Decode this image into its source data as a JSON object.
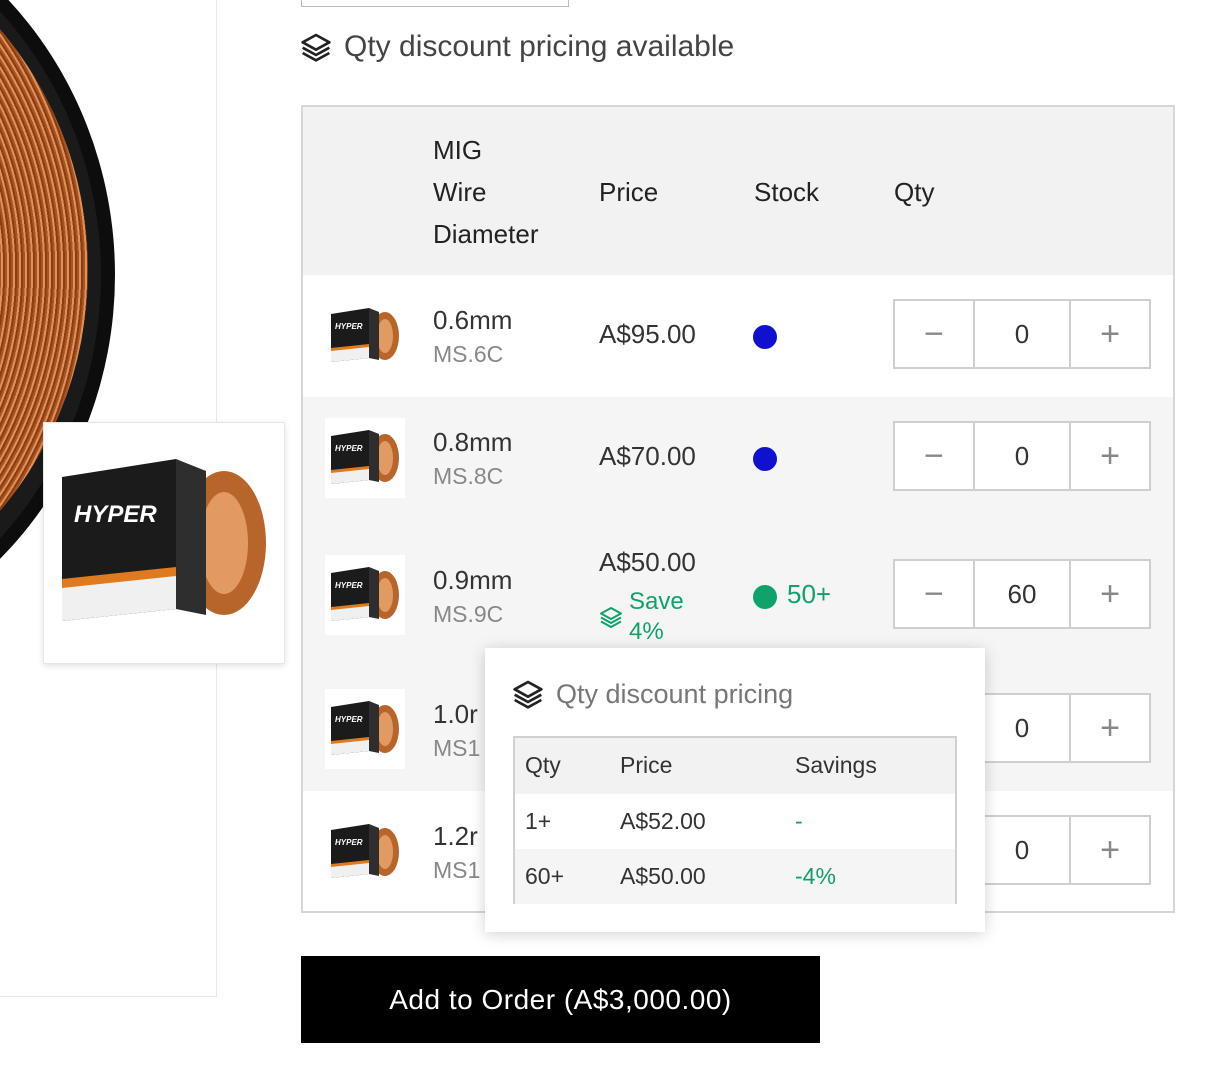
{
  "qty_note": {
    "icon": "layers-icon",
    "text": "Qty discount pricing available"
  },
  "table": {
    "headers": {
      "diameter": "MIG\nWire\nDiameter",
      "diameter_lines": [
        "MIG",
        "Wire",
        "Diameter"
      ],
      "price": "Price",
      "stock": "Stock",
      "qty": "Qty"
    },
    "rows": [
      {
        "diameter": "0.6mm",
        "code": "MS.6C",
        "price": "A$95.00",
        "stock_color": "#1010d0",
        "stock_text": "",
        "qty": "0"
      },
      {
        "diameter": "0.8mm",
        "code": "MS.8C",
        "price": "A$70.00",
        "stock_color": "#1010d0",
        "stock_text": "",
        "qty": "0"
      },
      {
        "diameter": "0.9mm",
        "code": "MS.9C",
        "price": "A$50.00",
        "save_lines": [
          "Save",
          "4%"
        ],
        "stock_color": "#0fa36b",
        "stock_text": "50+",
        "qty": "60"
      },
      {
        "diameter": "1.0r",
        "code": "MS1",
        "price": "",
        "stock_color": "",
        "stock_text": "",
        "qty": "0"
      },
      {
        "diameter": "1.2r",
        "code": "MS1",
        "price": "",
        "stock_color": "",
        "stock_text": "",
        "qty": "0"
      }
    ],
    "stepper": {
      "minus": "−",
      "plus": "+"
    }
  },
  "popover": {
    "title": "Qty discount pricing",
    "headers": {
      "qty": "Qty",
      "price": "Price",
      "savings": "Savings"
    },
    "rows": [
      {
        "qty": "1+",
        "price": "A$52.00",
        "savings": "-"
      },
      {
        "qty": "60+",
        "price": "A$50.00",
        "savings": "-4%"
      }
    ]
  },
  "add_button": {
    "label": "Add to Order (A$3,000.00)"
  },
  "colors": {
    "accent_green": "#0fa36b",
    "stock_blue": "#1010d0",
    "button_bg": "#000000"
  }
}
